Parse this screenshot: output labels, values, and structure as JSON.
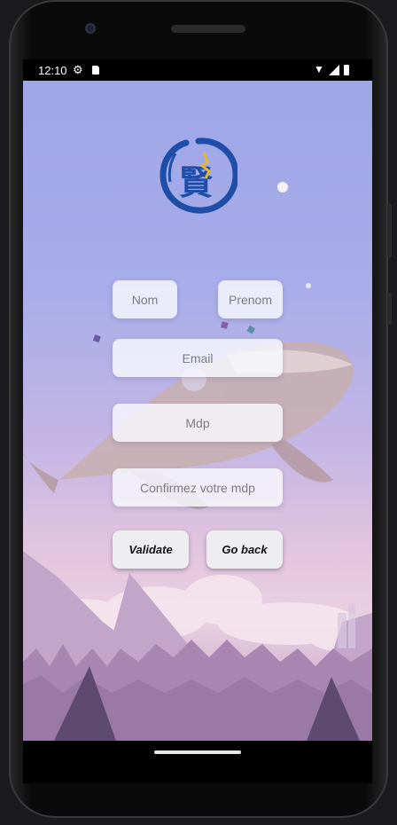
{
  "status_bar": {
    "time": "12:10",
    "icons": [
      "settings-icon",
      "sd-card-icon",
      "wifi-icon",
      "cell-signal-icon",
      "battery-icon"
    ]
  },
  "form": {
    "nom_placeholder": "Nom",
    "prenom_placeholder": "Prenom",
    "email_placeholder": "Email",
    "mdp_placeholder": "Mdp",
    "confirm_placeholder": "Confirmez votre mdp",
    "nom_value": "",
    "prenom_value": "",
    "email_value": "",
    "mdp_value": "",
    "confirm_value": ""
  },
  "buttons": {
    "validate_label": "Validate",
    "go_back_label": "Go back"
  },
  "logo": {
    "glyph": "賢",
    "accent_color": "#1f4ea8",
    "gold_color": "#e2b43a"
  },
  "colors": {
    "sky_top": "#9ea6e6",
    "sky_pink": "#e4c5df",
    "mountain": "#a98bb8"
  }
}
